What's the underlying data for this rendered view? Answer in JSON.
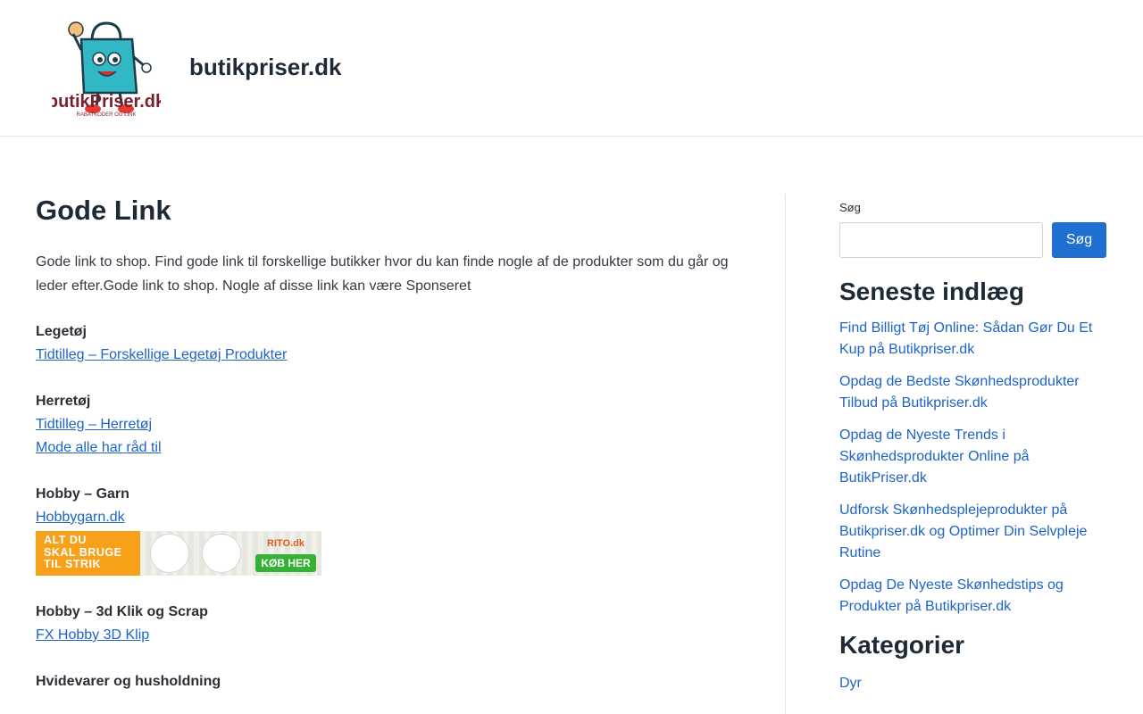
{
  "header": {
    "site_title": "butikpriser.dk",
    "logo": {
      "icon": "shopping-bag-mascot-logo",
      "text": "butikPriser.dk",
      "tagline": "RABATKODER OG LINK"
    }
  },
  "main": {
    "title": "Gode Link",
    "intro": "Gode link to shop. Find gode link til forskellige butikker hvor du kan finde nogle af de produkter som du går og leder efter.Gode link to shop. Nogle af disse link kan være Sponseret",
    "sections": [
      {
        "heading": "Legetøj",
        "links": [
          "Tidtilleg – Forskellige Legetøj Produkter"
        ]
      },
      {
        "heading": "Herretøj",
        "links": [
          "Tidtilleg – Herretøj",
          "Mode alle har råd til"
        ]
      },
      {
        "heading": "Hobby – Garn",
        "links": [
          "Hobbygarn.dk"
        ]
      },
      {
        "heading": "Hobby – 3d Klik og Scrap",
        "links": [
          "FX Hobby 3D Klip"
        ]
      },
      {
        "heading": "Hvidevarer og husholdning",
        "links": []
      }
    ],
    "banner": {
      "line1": "ALT DU",
      "line2": "SKAL BRUGE",
      "line3": "TIL STRIK",
      "brand": "RITO.dk",
      "cta": "KØB HER"
    }
  },
  "sidebar": {
    "search": {
      "label": "Søg",
      "button": "Søg",
      "value": ""
    },
    "recent_title": "Seneste indlæg",
    "recent_posts": [
      "Find Billigt Tøj Online: Sådan Gør Du Et Kup på Butikpriser.dk",
      "Opdag de Bedste Skønhedsprodukter Tilbud på Butikpriser.dk",
      "Opdag de Nyeste Trends i Skønhedsprodukter Online på ButikPriser.dk",
      "Udforsk Skønhedsplejeprodukter på Butikpriser.dk og Optimer Din Selvpleje Rutine",
      "Opdag De Nyeste Skønhedstips og Produkter på Butikpriser.dk"
    ],
    "categories_title": "Kategorier",
    "categories": [
      "Dyr"
    ]
  },
  "colors": {
    "link": "#1e63c7",
    "button": "#1e6fd0",
    "heading": "#1f2a37"
  }
}
